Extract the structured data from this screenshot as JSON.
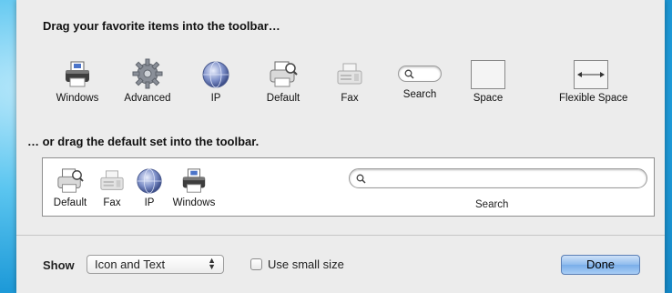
{
  "customize": {
    "heading_items": "Drag your favorite items into the toolbar…",
    "heading_default": "… or drag the default set into the toolbar.",
    "items": [
      {
        "label": "Windows",
        "icon": "printer-windows-icon"
      },
      {
        "label": "Advanced",
        "icon": "gear-icon"
      },
      {
        "label": "IP",
        "icon": "globe-icon"
      },
      {
        "label": "Default",
        "icon": "printer-default-icon"
      },
      {
        "label": "Fax",
        "icon": "fax-icon"
      },
      {
        "label": "Search",
        "icon": "search-field-icon"
      },
      {
        "label": "Space",
        "icon": "space-icon"
      },
      {
        "label": "Flexible Space",
        "icon": "flexible-space-icon"
      }
    ],
    "default_set": [
      {
        "label": "Default",
        "icon": "printer-default-icon"
      },
      {
        "label": "Fax",
        "icon": "fax-icon"
      },
      {
        "label": "IP",
        "icon": "globe-icon"
      },
      {
        "label": "Windows",
        "icon": "printer-windows-icon"
      },
      {
        "label": "Search",
        "icon": "search-field-icon"
      }
    ]
  },
  "footer": {
    "show_label": "Show",
    "show_value": "Icon and Text",
    "small_size_label": "Use small size",
    "small_size_checked": false,
    "done_label": "Done"
  },
  "colors": {
    "sheet": "#ececec",
    "done_button": "#8ebbee",
    "desktop": "#2aa7e0"
  }
}
